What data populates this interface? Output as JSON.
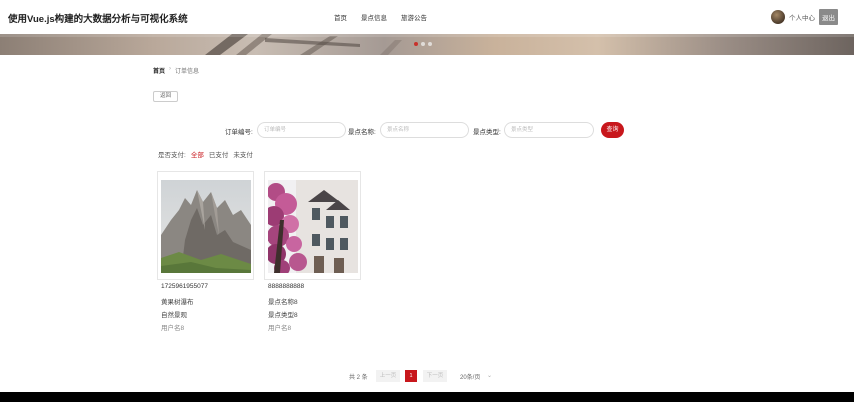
{
  "header": {
    "app_title": "使用Vue.js构建的大数据分析与可视化系统",
    "nav": [
      "首页",
      "景点信息",
      "旅游公告"
    ],
    "user_center": "个人中心",
    "logout": "退出"
  },
  "banner": {
    "slide_count": 3,
    "active_slide": 1
  },
  "breadcrumb": {
    "home": "首页",
    "separator": "›",
    "current": "订单信息"
  },
  "back_label": "返回",
  "search": {
    "order_no_label": "订单编号:",
    "order_no_placeholder": "订单编号",
    "spot_name_label": "景点名称:",
    "spot_name_placeholder": "景点名称",
    "spot_type_label": "景点类型:",
    "spot_type_placeholder": "景点类型",
    "button": "查询"
  },
  "filter": {
    "label": "是否支付:",
    "options": [
      "全部",
      "已支付",
      "未支付"
    ],
    "active_index": 0
  },
  "cards": [
    {
      "order_no": "1725961955077",
      "spot_name": "黄果树瀑布",
      "spot_type": "自然景观",
      "user": "用户名8"
    },
    {
      "order_no": "8888888888",
      "spot_name": "景点名称8",
      "spot_type": "景点类型8",
      "user": "用户名8"
    }
  ],
  "pagination": {
    "total_text": "共 2 条",
    "prev": "上一页",
    "current_page": "1",
    "next": "下一页",
    "page_size": "20条/页",
    "caret": "⌄"
  },
  "colors": {
    "accent": "#c8171c",
    "footer": "#000000"
  }
}
